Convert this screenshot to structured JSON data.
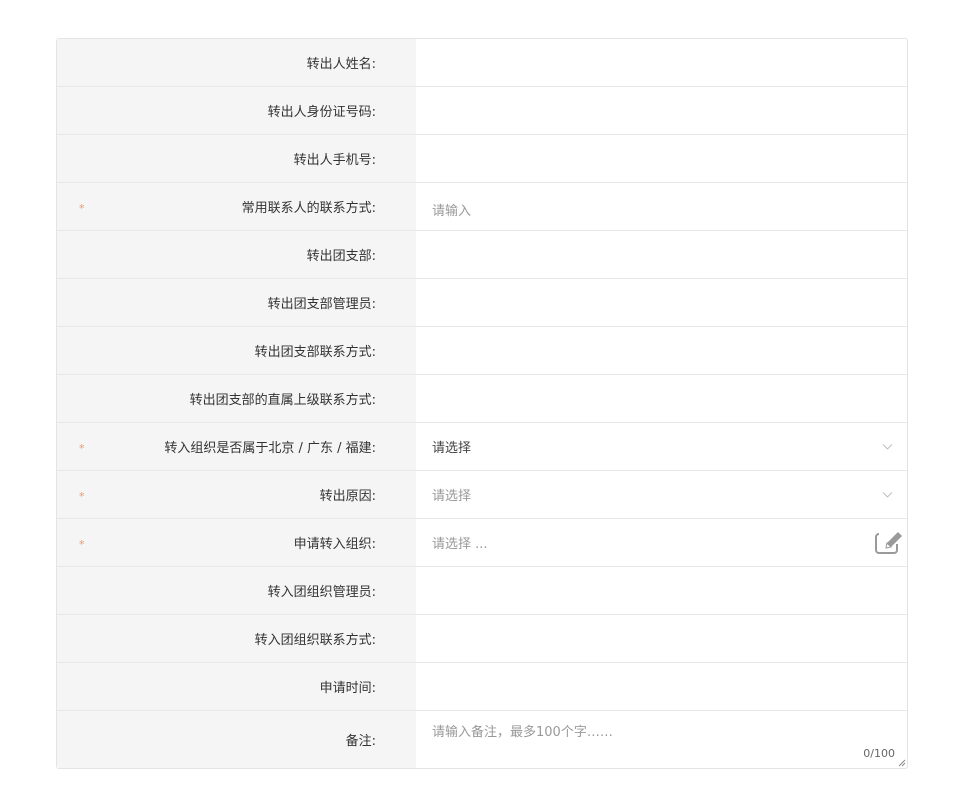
{
  "form": {
    "rows": [
      {
        "label": "转出人姓名:",
        "required": false,
        "value": ""
      },
      {
        "label": "转出人身份证号码:",
        "required": false,
        "value": ""
      },
      {
        "label": "转出人手机号:",
        "required": false,
        "value": ""
      },
      {
        "label": "常用联系人的联系方式:",
        "required": true,
        "placeholder": "请输入"
      },
      {
        "label": "转出团支部:",
        "required": false,
        "value": ""
      },
      {
        "label": "转出团支部管理员:",
        "required": false,
        "value": ""
      },
      {
        "label": "转出团支部联系方式:",
        "required": false,
        "value": ""
      },
      {
        "label": "转出团支部的直属上级联系方式:",
        "required": false,
        "value": ""
      },
      {
        "label": "转入组织是否属于北京 / 广东 / 福建:",
        "required": true,
        "selected": "请选择"
      },
      {
        "label": "转出原因:",
        "required": true,
        "placeholder": "请选择"
      },
      {
        "label": "申请转入组织:",
        "required": true,
        "placeholder": "请选择 ..."
      },
      {
        "label": "转入团组织管理员:",
        "required": false,
        "value": ""
      },
      {
        "label": "转入团组织联系方式:",
        "required": false,
        "value": ""
      },
      {
        "label": "申请时间:",
        "required": false,
        "value": ""
      },
      {
        "label": "备注:",
        "required": false,
        "placeholder": "请输入备注，最多100个字……",
        "counter": "0/100"
      }
    ],
    "required_mark": "*"
  }
}
